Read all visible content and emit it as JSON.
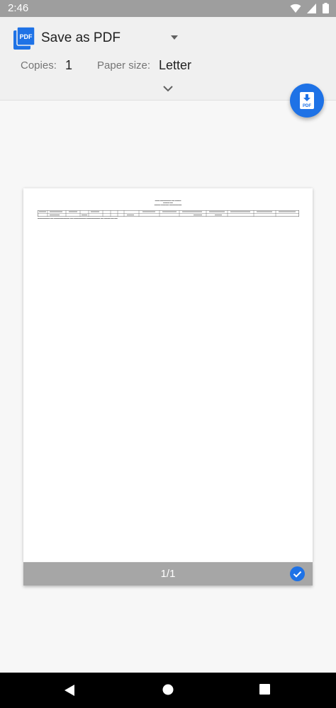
{
  "status_bar": {
    "time": "2:46"
  },
  "header": {
    "printer_name": "Save as PDF",
    "copies_label": "Copies:",
    "copies_value": "1",
    "paper_size_label": "Paper size:",
    "paper_size_value": "Letter"
  },
  "fab": {
    "icon": "pdf-download-icon"
  },
  "preview": {
    "page_counter": "1/1",
    "page_selected": true
  },
  "colors": {
    "accent": "#1e72e6",
    "status_bar": "#9e9e9e",
    "header_bg": "#f0f0f0",
    "page_footer": "#a6a6a6"
  }
}
